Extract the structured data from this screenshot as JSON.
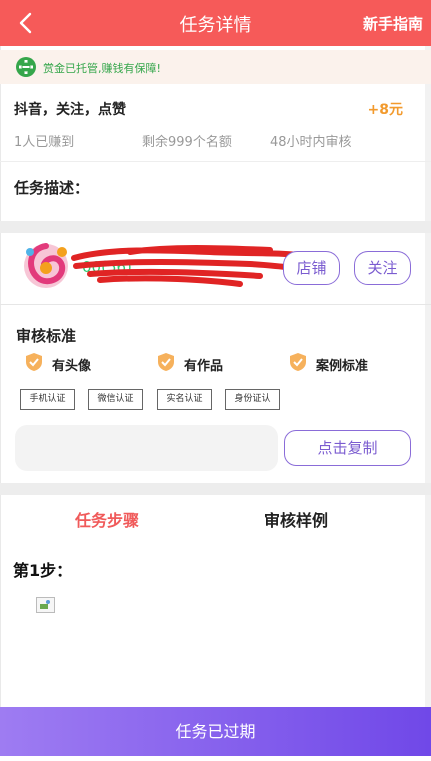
{
  "header": {
    "title": "任务详情",
    "guide_label": "新手指南"
  },
  "notice": {
    "text": "赏金已托管,赚钱有保障!"
  },
  "task": {
    "name": "抖音，关注，点赞",
    "reward": "+8元",
    "earned": "1人已赚到",
    "remaining": "剩余999个名额",
    "review_time": "48小时内审核",
    "description_title": "任务描述："
  },
  "shop": {
    "name_text": "00(56)",
    "shop_button": "店铺",
    "follow_button": "关注"
  },
  "review": {
    "title": "审核标准",
    "requirements": [
      "有头像",
      "有作品",
      "案例标准"
    ],
    "tags": [
      "手机认证",
      "微信认证",
      "实名认证",
      "身份证认"
    ]
  },
  "copy_button": "点击复制",
  "tabs": {
    "steps": "任务步骤",
    "samples": "审核样例"
  },
  "step": {
    "title": "第1步："
  },
  "bottom_bar": "任务已过期",
  "colors": {
    "header": "#f65a59",
    "reward": "#f29a2d",
    "accent": "#7b5cd0",
    "notice_text": "#35a64b",
    "active_tab": "#f05a5a"
  }
}
